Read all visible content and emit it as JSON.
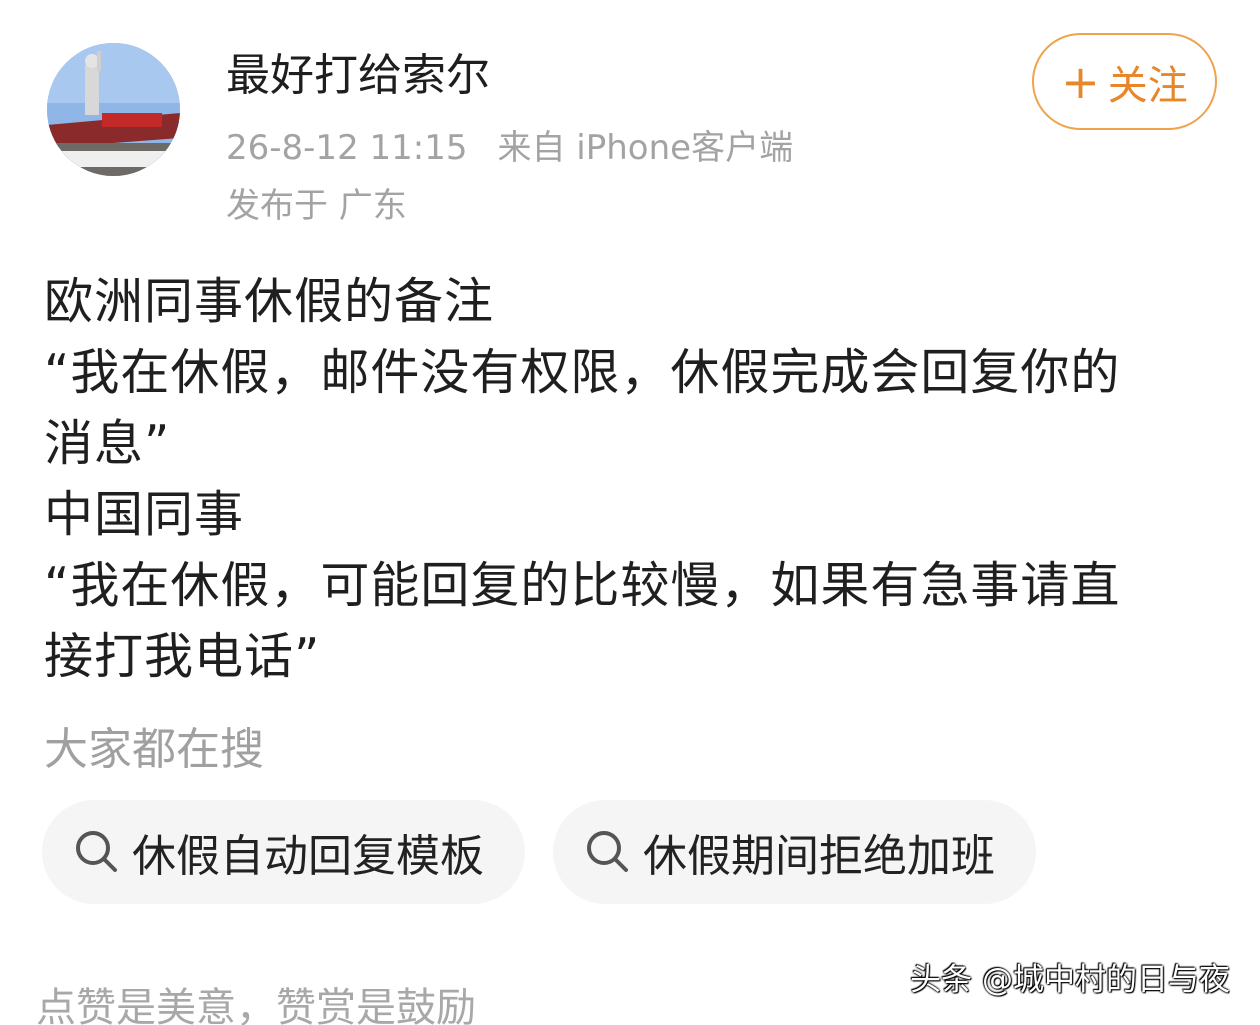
{
  "post": {
    "author": "最好打给索尔",
    "timestamp": "26-8-12 11:15",
    "source": "来自 iPhone客户端",
    "location": "发布于 广东",
    "follow_label": "关注",
    "lines": [
      "欧洲同事休假的备注",
      "“我在休假，邮件没有权限，休假完成会回复你的",
      "消息”",
      "中国同事",
      "“我在休假，可能回复的比较慢，如果有急事请直",
      "接打我电话”"
    ]
  },
  "searches": {
    "title": "大家都在搜",
    "items": [
      "休假自动回复模板",
      "休假期间拒绝加班"
    ]
  },
  "footer": {
    "note": "点赞是美意，赞赏是鼓励",
    "watermark": "头条 @城中村的日与夜"
  },
  "colors": {
    "accent": "#e8862a",
    "muted_text": "#a3a3a3",
    "chip_bg": "#f5f5f5"
  },
  "icons": {
    "follow": "plus-icon",
    "search": "search-icon"
  }
}
